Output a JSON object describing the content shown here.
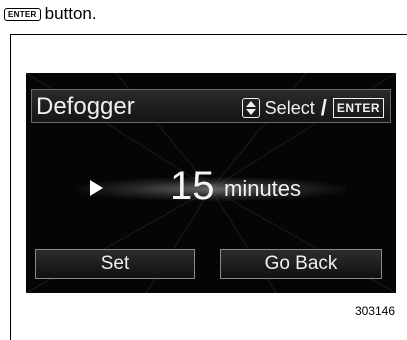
{
  "caption": {
    "key_label": "ENTER",
    "text": "button."
  },
  "screen": {
    "title": "Defogger",
    "hint": {
      "icon": "up-down-arrows-icon",
      "select_label": "Select",
      "separator": "/",
      "enter_label": "ENTER"
    },
    "value": {
      "number": "15",
      "unit": "minutes"
    },
    "buttons": {
      "set_label": "Set",
      "back_label": "Go Back"
    }
  },
  "figure_id": "303146"
}
